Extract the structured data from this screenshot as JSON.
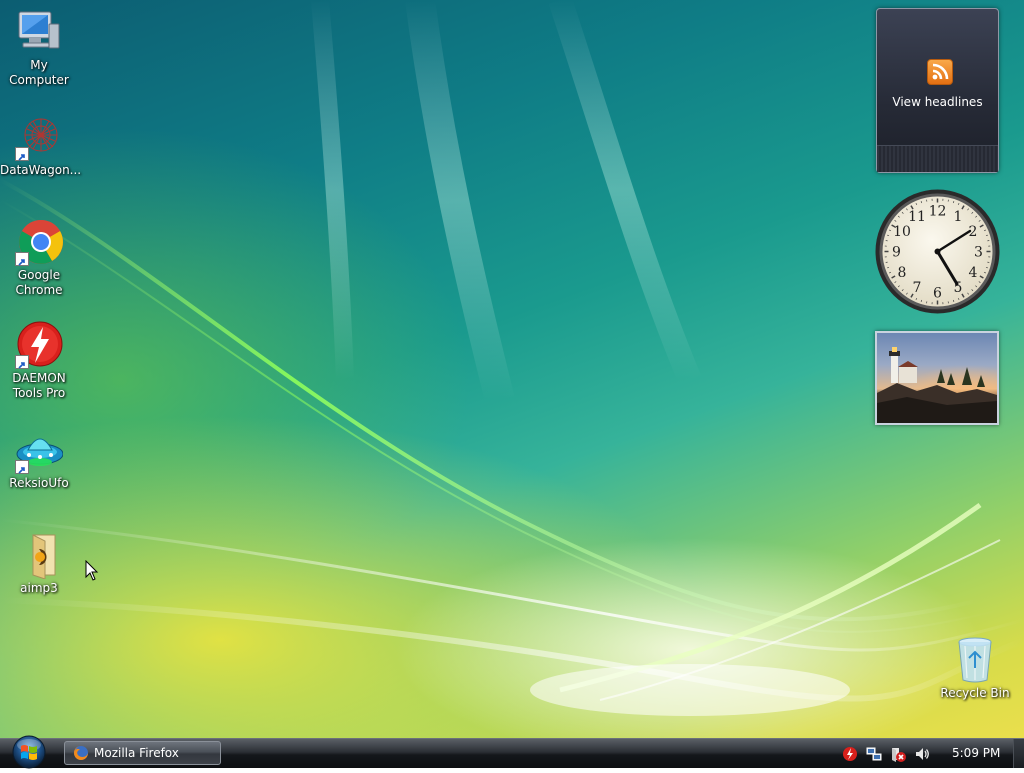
{
  "desktop": {
    "icons": [
      {
        "label": "My Computer",
        "icon": "computer-icon"
      },
      {
        "label": "DataWagon...",
        "icon": "datawagon-icon"
      },
      {
        "label": "Google Chrome",
        "icon": "chrome-icon"
      },
      {
        "label": "DAEMON Tools Pro",
        "icon": "daemon-tools-icon"
      },
      {
        "label": "ReksioUfo",
        "icon": "reksioufo-icon"
      },
      {
        "label": "aimp3",
        "icon": "folder-icon"
      },
      {
        "label": "Recycle Bin",
        "icon": "recycle-bin-icon"
      }
    ]
  },
  "gadgets": {
    "feed": {
      "label": "View headlines",
      "icon": "rss-icon"
    },
    "clock": {
      "numerals": [
        "12",
        "1",
        "2",
        "3",
        "4",
        "5",
        "6",
        "7",
        "8",
        "9",
        "10",
        "11"
      ],
      "time": "5:09"
    },
    "photo": {
      "subject": "lighthouse at sunset"
    }
  },
  "taskbar": {
    "start_icon": "windows-logo-icon",
    "tasks": [
      {
        "label": "Mozilla Firefox",
        "icon": "firefox-icon"
      }
    ],
    "tray": {
      "icons": [
        "daemon-tools-tray-icon",
        "network-icon",
        "security-alert-icon",
        "volume-icon"
      ],
      "clock": "5:09 PM"
    }
  },
  "colors": {
    "rss_orange": "#f08a24",
    "taskbar_dark": "#14171b",
    "wallpaper_teal": "#0f7d86",
    "wallpaper_yellow": "#eadf4c"
  }
}
